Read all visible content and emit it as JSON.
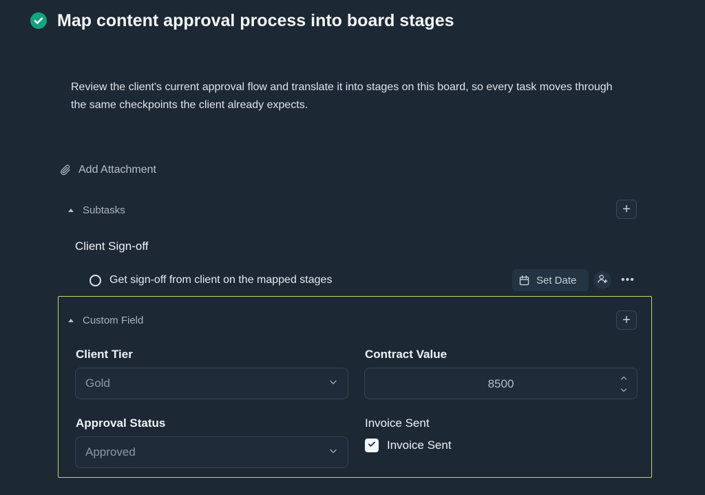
{
  "task": {
    "title": "Map content approval process into board stages",
    "description": "Review the client's current approval flow and translate it into stages on this board, so every task moves through the same checkpoints the client already expects.",
    "status_icon": "check-circle-icon",
    "status_color": "#14a37f"
  },
  "attachment": {
    "label": "Add Attachment",
    "icon": "paperclip-icon"
  },
  "subtasks": {
    "section_label": "Subtasks",
    "group_name": "Client Sign-off",
    "items": [
      {
        "label": "Get sign-off from client on the mapped stages",
        "set_date_label": "Set Date"
      }
    ]
  },
  "custom_field": {
    "section_label": "Custom Field",
    "highlight_color": "#c4d46a",
    "fields": {
      "client_tier": {
        "label": "Client Tier",
        "value": "Gold"
      },
      "contract_value": {
        "label": "Contract Value",
        "value": "8500"
      },
      "approval_status": {
        "label": "Approval Status",
        "value": "Approved"
      },
      "invoice_sent": {
        "label": "Invoice Sent",
        "checkbox_label": "Invoice Sent",
        "checked": true
      }
    }
  }
}
